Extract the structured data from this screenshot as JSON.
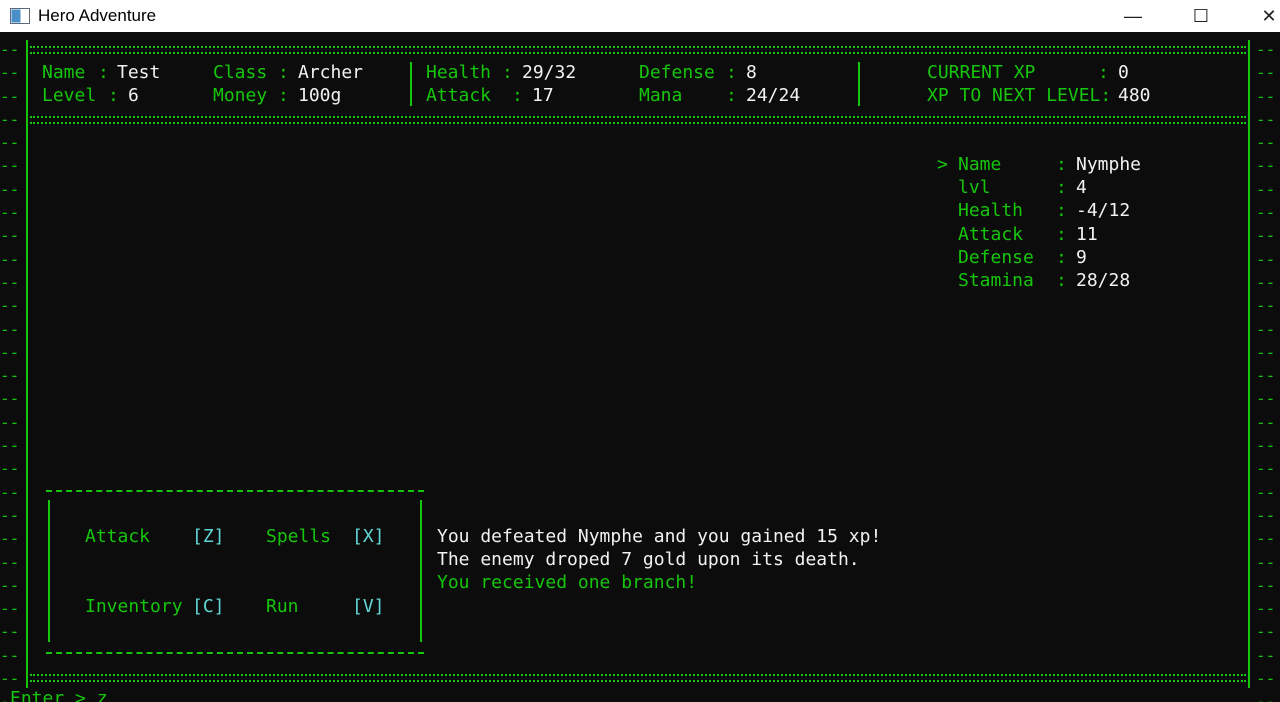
{
  "window": {
    "title": "Hero Adventure",
    "minimize": "—",
    "maximize": "☐",
    "close": "✕"
  },
  "player": {
    "name_label": "Name",
    "name": "Test",
    "level_label": "Level",
    "level": "6",
    "class_label": "Class",
    "class": "Archer",
    "money_label": "Money",
    "money": "100g",
    "health_label": "Health",
    "health": "29/32",
    "attack_label": "Attack",
    "attack": "17",
    "defense_label": "Defense",
    "defense": "8",
    "mana_label": "Mana",
    "mana": "24/24",
    "current_xp_label": "CURRENT XP",
    "current_xp": "0",
    "next_level_label": "XP TO NEXT LEVEL:",
    "next_level": "480"
  },
  "enemy": {
    "pointer": ">",
    "name_label": "Name",
    "name": "Nymphe",
    "lvl_label": "lvl",
    "lvl": "4",
    "health_label": "Health",
    "health": "-4/12",
    "attack_label": "Attack",
    "attack": "11",
    "defense_label": "Defense",
    "defense": "9",
    "stamina_label": "Stamina",
    "stamina": "28/28"
  },
  "actions": {
    "attack": "Attack",
    "attack_key": "[Z]",
    "spells": "Spells",
    "spells_key": "[X]",
    "inventory": "Inventory",
    "inventory_key": "[C]",
    "run": "Run",
    "run_key": "[V]"
  },
  "log": [
    "You defeated Nymphe and you gained 15 xp!",
    "The enemy droped 7 gold upon its death.",
    "You received one branch!"
  ],
  "prompt": {
    "text": "Enter > z"
  },
  "colors": {
    "background": "#0c0c0c",
    "green": "#16c60c",
    "white": "#f2f2f2",
    "cyan": "#61d6d6"
  }
}
